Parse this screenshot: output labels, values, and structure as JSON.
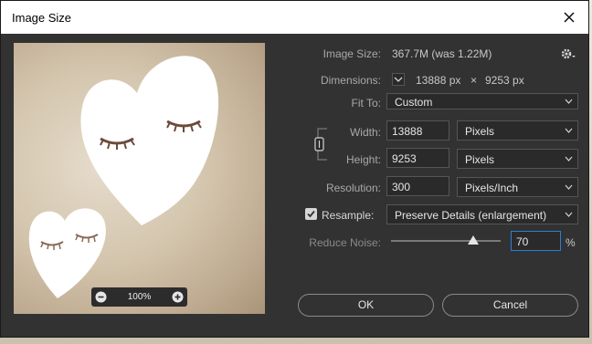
{
  "dialog": {
    "title": "Image Size",
    "close_icon": "close-icon"
  },
  "info": {
    "image_size_label": "Image Size:",
    "image_size_value": "367.7M (was 1.22M)",
    "dimensions_label": "Dimensions:",
    "dim_width": "13888 px",
    "dim_x": "×",
    "dim_height": "9253 px"
  },
  "fit_to": {
    "label": "Fit To:",
    "value": "Custom"
  },
  "width": {
    "label": "Width:",
    "value": "13888",
    "unit": "Pixels"
  },
  "height": {
    "label": "Height:",
    "value": "9253",
    "unit": "Pixels"
  },
  "resolution": {
    "label": "Resolution:",
    "value": "300",
    "unit": "Pixels/Inch"
  },
  "resample": {
    "label": "Resample:",
    "checked": true,
    "value": "Preserve Details (enlargement)"
  },
  "reduce_noise": {
    "label": "Reduce Noise:",
    "value": "70",
    "unit": "%",
    "level": 0.7
  },
  "preview": {
    "zoom": "100%"
  },
  "buttons": {
    "ok": "OK",
    "cancel": "Cancel"
  },
  "colors": {
    "dialog_bg": "#323232",
    "field_bg": "#2a2a2a",
    "active_border": "#2a7fd4"
  }
}
